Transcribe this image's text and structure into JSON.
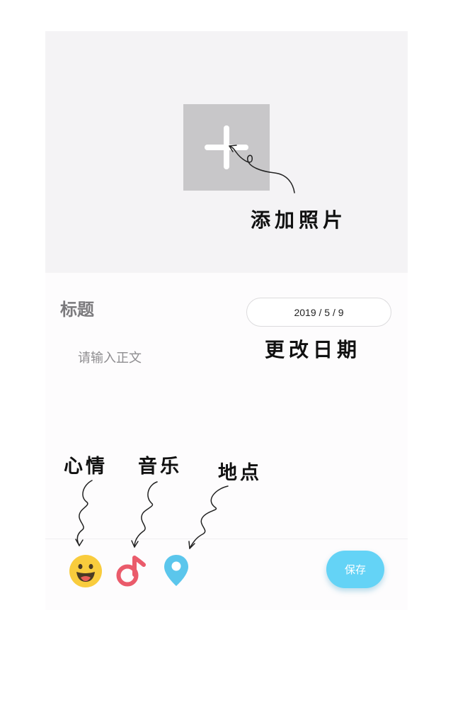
{
  "photo": {
    "add_button_icon": "plus-icon"
  },
  "editor": {
    "title_placeholder": "标题",
    "date": "2019 / 5 / 9",
    "body_placeholder": "请输入正文"
  },
  "toolbar": {
    "mood_icon": "smiley-face-icon",
    "music_icon": "music-note-icon",
    "location_icon": "map-pin-icon",
    "save_label": "保存"
  },
  "annotations": {
    "add_photo": "添加照片",
    "change_date": "更改日期",
    "mood": "心情",
    "music": "音乐",
    "location": "地点"
  },
  "colors": {
    "save_button": "#64d3f6",
    "mood_icon": "#f9cc3d",
    "music_icon": "#ea5b6b",
    "location_icon": "#5bc6ec",
    "photo_area": "#f4f3f5",
    "add_button": "#c8c7c9"
  }
}
